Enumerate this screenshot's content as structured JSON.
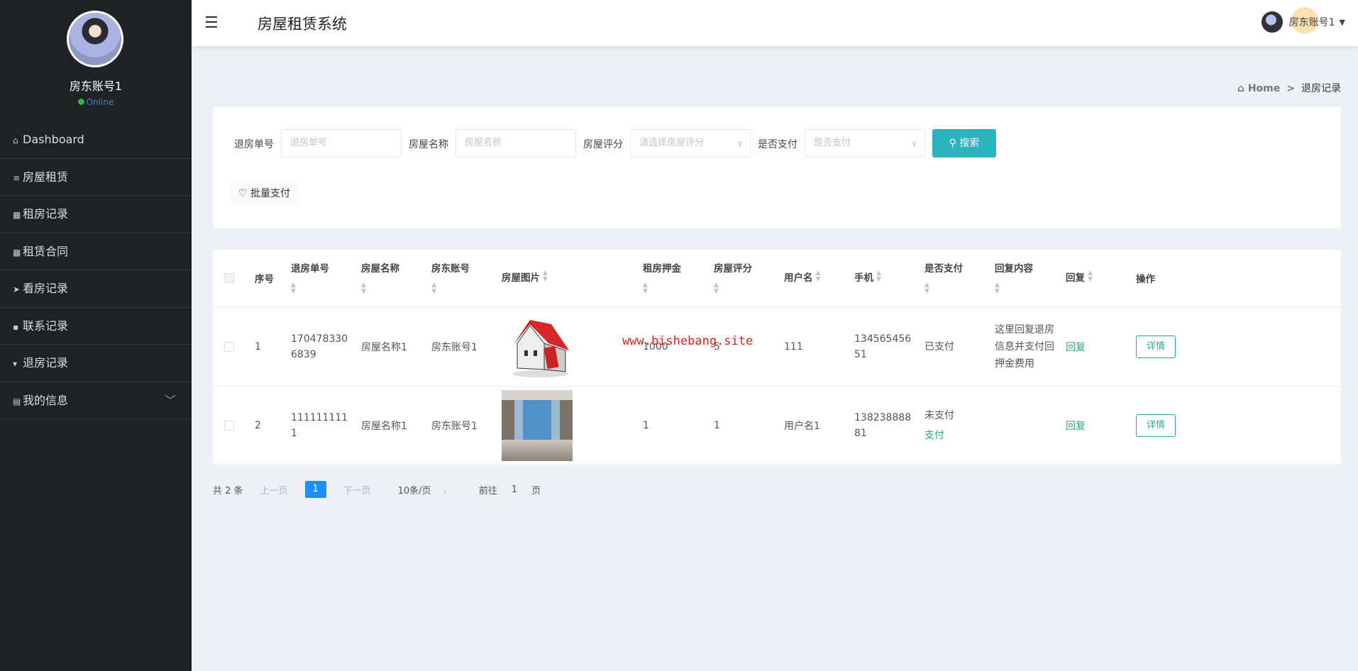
{
  "sidebar": {
    "username": "房东账号1",
    "status": "Online",
    "items": [
      {
        "label": "Dashboard",
        "icon": "home-icon"
      },
      {
        "label": "房屋租赁",
        "icon": "list-icon"
      },
      {
        "label": "租房记录",
        "icon": "grid-icon"
      },
      {
        "label": "租赁合同",
        "icon": "grid-icon"
      },
      {
        "label": "看房记录",
        "icon": "send-icon"
      },
      {
        "label": "联系记录",
        "icon": "comment-icon"
      },
      {
        "label": "退房记录",
        "icon": "thumb-icon"
      },
      {
        "label": "我的信息",
        "icon": "card-icon"
      }
    ]
  },
  "header": {
    "title": "房屋租赁系统",
    "user": "房东账号1"
  },
  "breadcrumb": {
    "home": "Home",
    "sep": ">",
    "current": "退房记录"
  },
  "search": {
    "fields": [
      {
        "label": "退房单号",
        "placeholder": "退房单号"
      },
      {
        "label": "房屋名称",
        "placeholder": "房屋名称"
      },
      {
        "label": "房屋评分",
        "placeholder": "请选择房屋评分"
      },
      {
        "label": "是否支付",
        "placeholder": "是否支付"
      }
    ],
    "search_label": "搜索",
    "batch_label": "批量支付"
  },
  "table": {
    "headers": [
      "序号",
      "退房单号",
      "房屋名称",
      "房东账号",
      "房屋图片",
      "租房押金",
      "房屋评分",
      "用户名",
      "手机",
      "是否支付",
      "回复内容",
      "回复",
      "操作"
    ],
    "rows": [
      {
        "idx": "1",
        "no": "1704783306839",
        "name": "房屋名称1",
        "owner": "房东账号1",
        "deposit": "1000",
        "score": "5",
        "user": "111",
        "phone": "13456545651",
        "paid": "已支付",
        "pay_link": "",
        "reply_content": "这里回复退房信息并支付回押金费用",
        "reply": "回复",
        "detail": "详情"
      },
      {
        "idx": "2",
        "no": "1111111111",
        "name": "房屋名称1",
        "owner": "房东账号1",
        "deposit": "1",
        "score": "1",
        "user": "用户名1",
        "phone": "13823888881",
        "paid": "未支付",
        "pay_link": "支付",
        "reply_content": "",
        "reply": "回复",
        "detail": "详情"
      }
    ]
  },
  "watermark": "www.bishebang.site",
  "pagination": {
    "total": "共 2 条",
    "prev": "上一页",
    "current": "1",
    "next": "下一页",
    "page_size": "10条/页",
    "goto": "前往",
    "goto_value": "1",
    "page_unit": "页"
  }
}
